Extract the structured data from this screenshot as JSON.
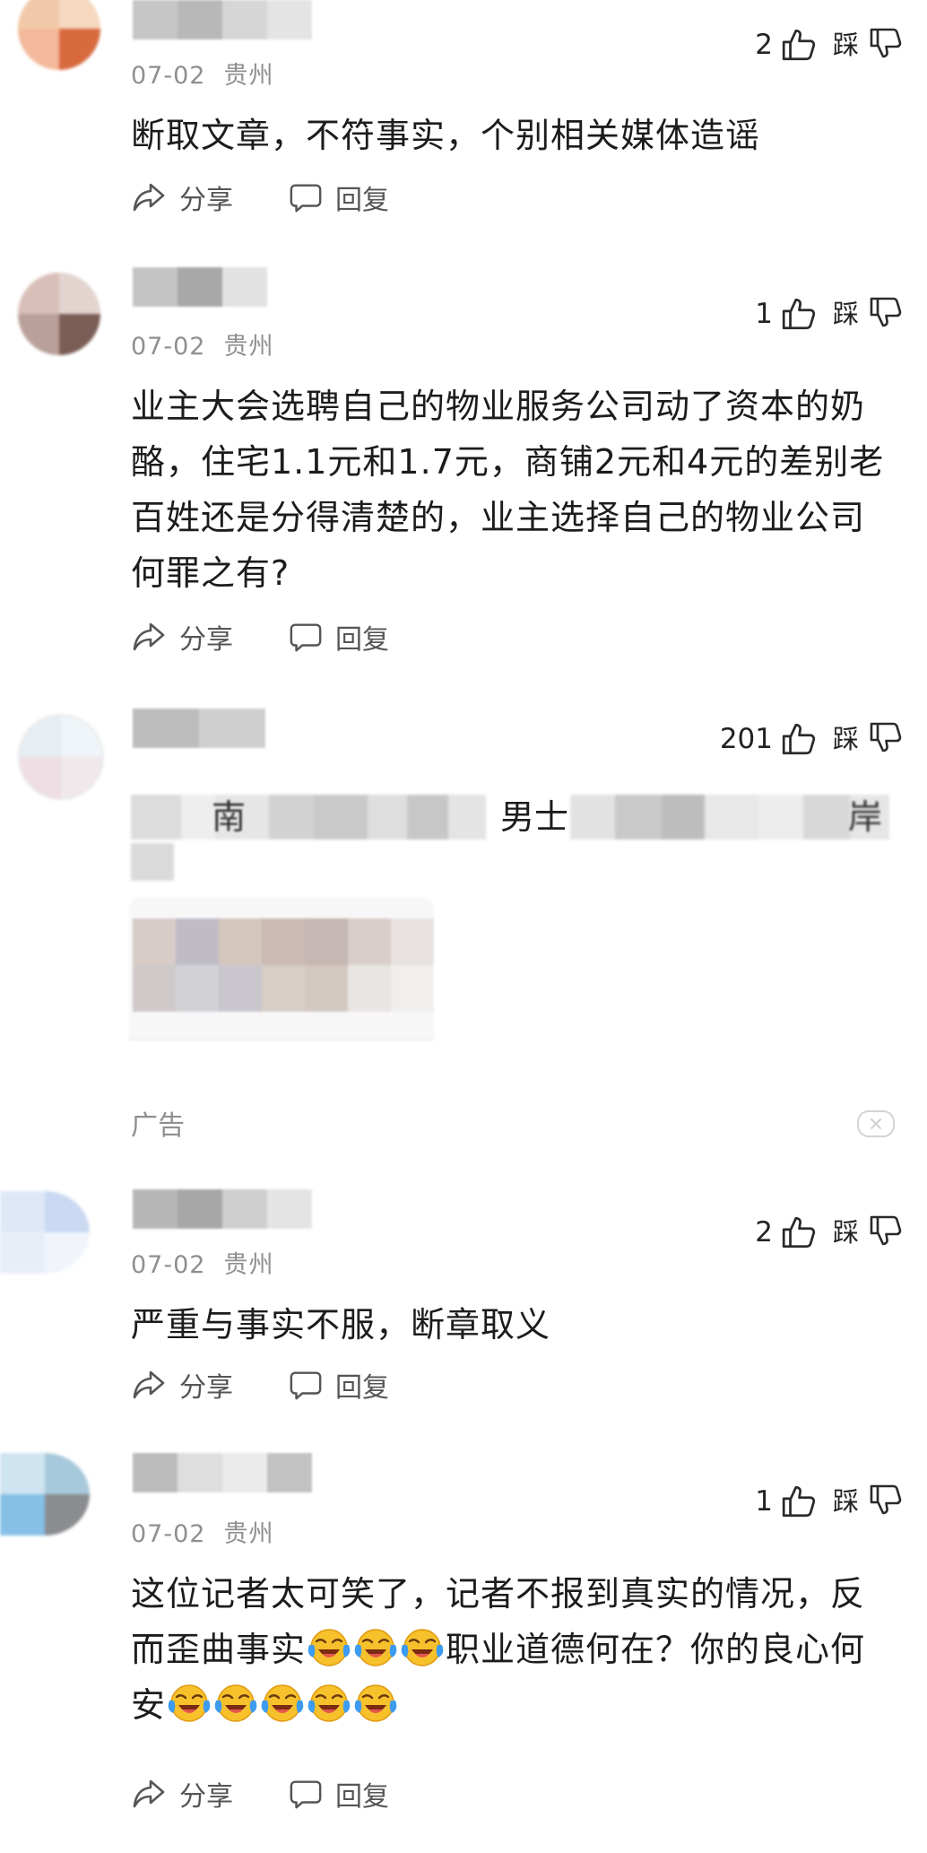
{
  "colors": {
    "text": "#1c1c1c",
    "meta": "#8f8f8f",
    "action": "#555555",
    "icon": "#2a2a2a"
  },
  "icons": {
    "like": "thumbs-up-icon",
    "dislike": "thumbs-down-icon",
    "share": "share-arrow-icon",
    "reply": "speech-bubble-icon",
    "close": "close-icon",
    "emoji": "crying-laughing-emoji-icon"
  },
  "comments": [
    {
      "date": "07-02",
      "location": "贵州",
      "likes": "2",
      "dislike_label": "踩",
      "text": "断取文章，不符事实，个别相关媒体造谣",
      "share_label": "分享",
      "reply_label": "回复"
    },
    {
      "date": "07-02",
      "location": "贵州",
      "likes": "1",
      "dislike_label": "踩",
      "text": "业主大会选聘自己的物业服务公司动了资本的奶酪，住宅1.1元和1.7元，商铺2元和4元的差别老百姓还是分得清楚的，业主选择自己的物业公司何罪之有?",
      "share_label": "分享",
      "reply_label": "回复"
    },
    {
      "likes": "201",
      "dislike_label": "踩",
      "fragment_1": "南",
      "fragment_2": "男士",
      "fragment_3": "岸",
      "ad_label": "广告"
    },
    {
      "date": "07-02",
      "location": "贵州",
      "likes": "2",
      "dislike_label": "踩",
      "text": "严重与事实不服，断章取义",
      "share_label": "分享",
      "reply_label": "回复"
    },
    {
      "date": "07-02",
      "location": "贵州",
      "likes": "1",
      "dislike_label": "踩",
      "text_1": "这位记者太可笑了，记者不报到真实的情况，反而歪曲事实",
      "text_2": "职业道德何在？你的良心何安",
      "share_label": "分享",
      "reply_label": "回复"
    }
  ]
}
